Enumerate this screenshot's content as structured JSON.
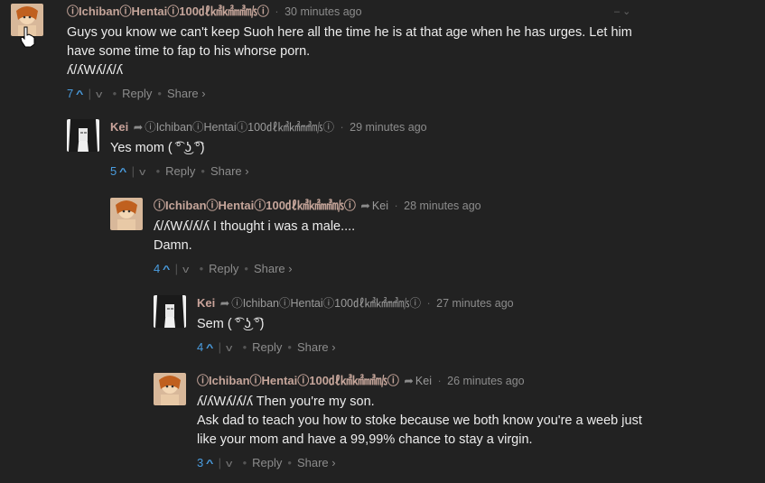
{
  "comments": [
    {
      "author": "ⓘIchibanⓘHentaiⓘ100㎗㎦㎢㎣㎧ⓘ",
      "time": "30 minutes ago",
      "lines": [
        "Guys you know we can't keep Suoh here all the time he is at that age when he has urges. Let him",
        "have some time to fap to his whorse porn.",
        "ʎ/ʎWʎ/ʎ/ʎ"
      ],
      "votes": "7",
      "reply": "Reply",
      "share": "Share ›",
      "topright": "–  ⌄"
    },
    {
      "author": "Kei",
      "reply_to": "ⓘIchibanⓘHentaiⓘ100㎗㎦㎢㎣㎧ⓘ",
      "time": "29 minutes ago",
      "lines": [
        "Yes mom ( ͡° ͜ʖ ͡°)"
      ],
      "votes": "5",
      "reply": "Reply",
      "share": "Share ›"
    },
    {
      "author": "ⓘIchibanⓘHentaiⓘ100㎗㎦㎢㎣㎧ⓘ",
      "reply_to": "Kei",
      "time": "28 minutes ago",
      "lines": [
        "ʎ/ʎWʎ/ʎ/ʎ I thought i was a male....",
        "Damn."
      ],
      "votes": "4",
      "reply": "Reply",
      "share": "Share ›"
    },
    {
      "author": "Kei",
      "reply_to": "ⓘIchibanⓘHentaiⓘ100㎗㎦㎢㎣㎧ⓘ",
      "time": "27 minutes ago",
      "lines": [
        "Sem ( ͡° ͜ʖ ͡°)"
      ],
      "votes": "4",
      "reply": "Reply",
      "share": "Share ›"
    },
    {
      "author": "ⓘIchibanⓘHentaiⓘ100㎗㎦㎢㎣㎧ⓘ",
      "reply_to": "Kei",
      "time": "26 minutes ago",
      "lines": [
        "ʎ/ʎWʎ/ʎ/ʎ Then you're my son.",
        "Ask dad to teach you how to stoke because we both know you're a weeb just",
        "like your mom and have a 99,99% chance to stay a virgin."
      ],
      "votes": "3",
      "reply": "Reply",
      "share": "Share ›"
    }
  ],
  "colors": {
    "background": "#222222",
    "accent": "#4a9de0",
    "author": "#c5a59a",
    "muted": "#8c8c8c"
  },
  "icons": {
    "upvote": "chevron-up-icon",
    "downvote": "chevron-down-icon",
    "reply_arrow": "reply-arrow-icon"
  }
}
